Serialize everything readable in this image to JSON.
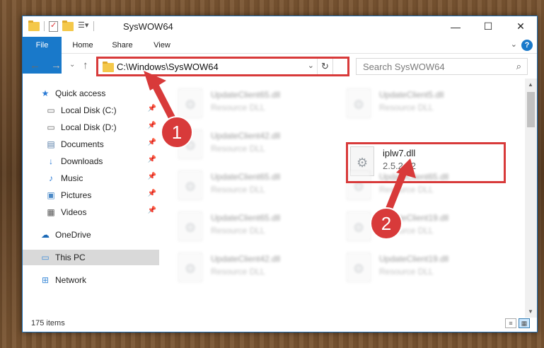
{
  "window": {
    "title": "SysWOW64",
    "controls": {
      "minimize": "—",
      "maximize": "☐",
      "close": "✕"
    }
  },
  "ribbon": {
    "tabs": [
      "File",
      "Home",
      "Share",
      "View"
    ],
    "help": "?"
  },
  "navigation": {
    "address_path": "C:\\Windows\\SysWOW64",
    "search_placeholder": "Search SysWOW64"
  },
  "sidebar": {
    "items": [
      {
        "label": "Quick access",
        "icon": "star-icon",
        "pinned": false
      },
      {
        "label": "Local Disk (C:)",
        "icon": "drive-icon",
        "pinned": true
      },
      {
        "label": "Local Disk (D:)",
        "icon": "drive-icon",
        "pinned": true
      },
      {
        "label": "Documents",
        "icon": "document-icon",
        "pinned": true
      },
      {
        "label": "Downloads",
        "icon": "download-icon",
        "pinned": true
      },
      {
        "label": "Music",
        "icon": "music-icon",
        "pinned": true
      },
      {
        "label": "Pictures",
        "icon": "picture-icon",
        "pinned": true
      },
      {
        "label": "Videos",
        "icon": "video-icon",
        "pinned": true
      },
      {
        "label": "OneDrive",
        "icon": "cloud-icon",
        "pinned": false
      },
      {
        "label": "This PC",
        "icon": "computer-icon",
        "pinned": false,
        "selected": true
      },
      {
        "label": "Network",
        "icon": "network-icon",
        "pinned": false
      }
    ]
  },
  "files": [
    {
      "name": "UpdateClient65.dll",
      "desc": "Resource DLL"
    },
    {
      "name": "UpdateClient5.dll",
      "desc": "Resource DLL"
    },
    {
      "name": "UpdateClient42.dll",
      "desc": "Resource DLL"
    },
    {
      "name": "iplw7.dll",
      "desc": "2.5.2.82"
    },
    {
      "name": "UpdateClient65.dll",
      "desc": "Resource DLL"
    },
    {
      "name": "UpdateClient65.dll",
      "desc": "Resource DLL"
    },
    {
      "name": "UpdateClient65.dll",
      "desc": "Resource DLL"
    },
    {
      "name": "UpdateClient19.dll",
      "desc": "Resource DLL"
    },
    {
      "name": "UpdateClient42.dll",
      "desc": "Resource DLL"
    },
    {
      "name": "UpdateClient19.dll",
      "desc": "Resource DLL"
    }
  ],
  "status": {
    "item_count": "175 items"
  },
  "annotations": {
    "badge_1": "1",
    "badge_2": "2",
    "color": "#d83a3a"
  }
}
